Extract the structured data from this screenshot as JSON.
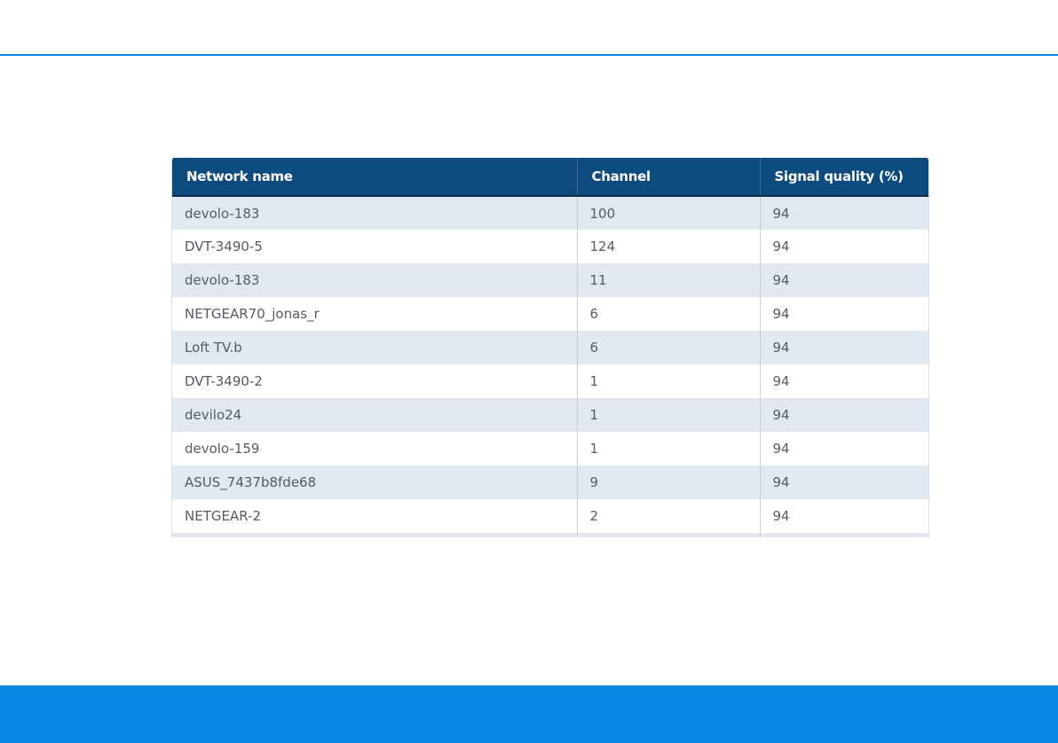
{
  "colors": {
    "accent": "#0a87e0",
    "header_bg": "#0d4a7e",
    "row_alt_bg": "#e2e8ef",
    "text": "#555b61"
  },
  "table": {
    "columns": [
      "Network name",
      "Channel",
      "Signal quality (%)"
    ],
    "rows": [
      {
        "name": "devolo-183",
        "channel": "100",
        "signal": "94"
      },
      {
        "name": "DVT-3490-5",
        "channel": "124",
        "signal": "94"
      },
      {
        "name": "devolo-183",
        "channel": "11",
        "signal": "94"
      },
      {
        "name": "NETGEAR70_jonas_r",
        "channel": "6",
        "signal": "94"
      },
      {
        "name": "Loft TV.b",
        "channel": "6",
        "signal": "94"
      },
      {
        "name": "DVT-3490-2",
        "channel": "1",
        "signal": "94"
      },
      {
        "name": "devilo24",
        "channel": "1",
        "signal": "94"
      },
      {
        "name": "devolo-159",
        "channel": "1",
        "signal": "94"
      },
      {
        "name": "ASUS_7437b8fde68",
        "channel": "9",
        "signal": "94"
      },
      {
        "name": "NETGEAR-2",
        "channel": "2",
        "signal": "94"
      }
    ]
  }
}
